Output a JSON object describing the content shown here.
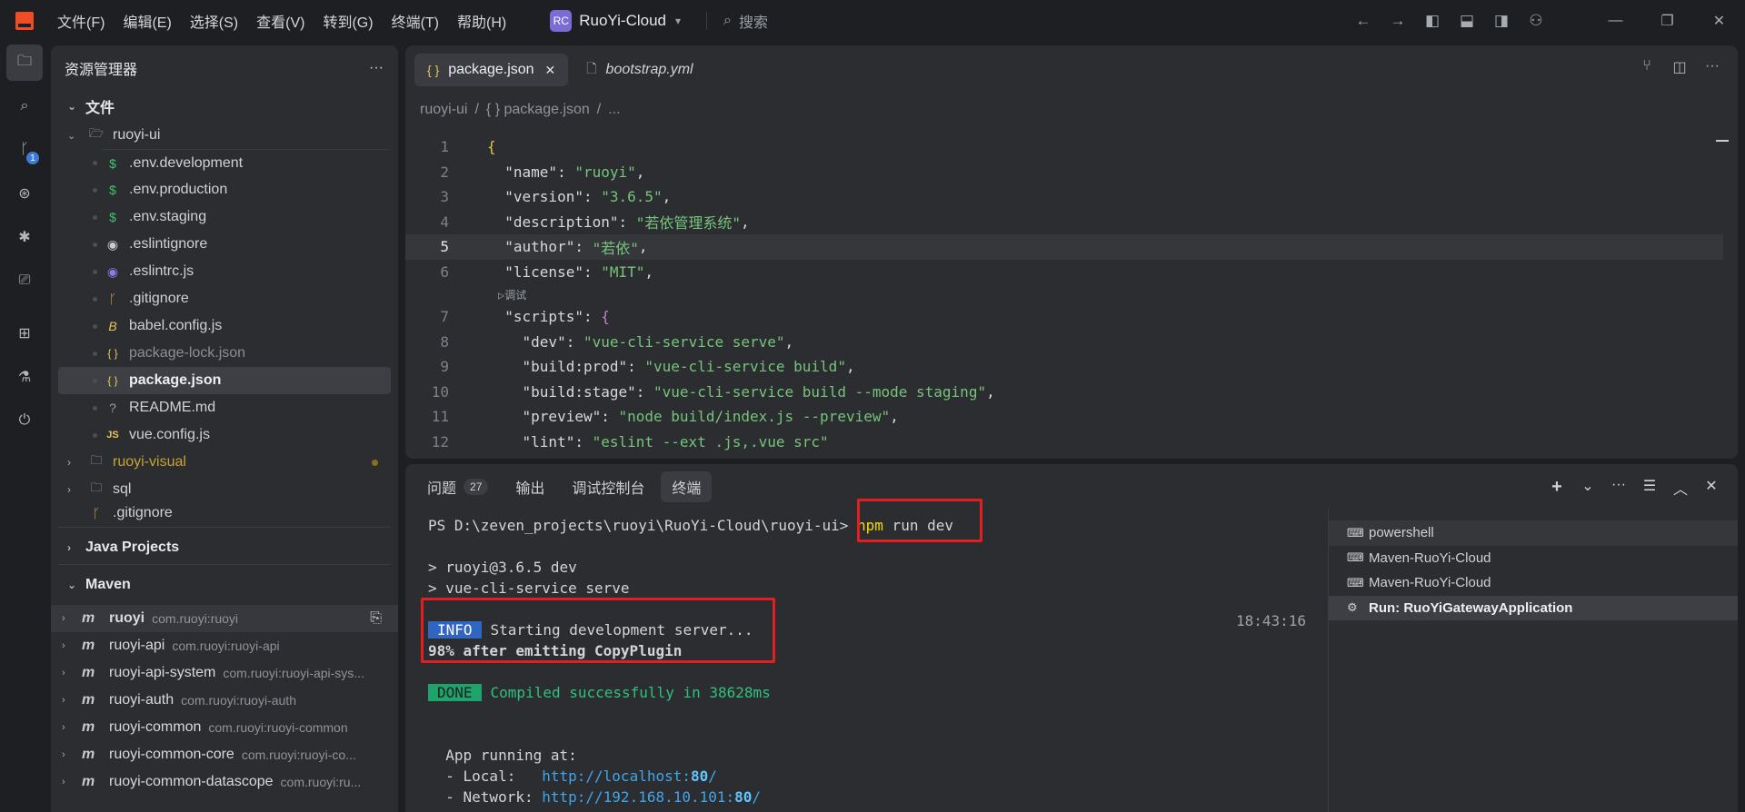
{
  "titlebar": {
    "menu": [
      "文件(F)",
      "编辑(E)",
      "选择(S)",
      "查看(V)",
      "转到(G)",
      "终端(T)",
      "帮助(H)"
    ],
    "project_badge": "RC",
    "project_name": "RuoYi-Cloud",
    "search_placeholder": "搜索",
    "colors": {
      "logo": "#f24c24",
      "project_badge": "#7b6bd6"
    }
  },
  "activitybar": {
    "items": [
      "explorer-icon",
      "search-icon",
      "source-control-icon",
      "remote-icon",
      "debug-icon",
      "remote-explorer-icon",
      "extensions-icon",
      "testing-icon",
      "power-icon"
    ],
    "source_control_badge": "1"
  },
  "sidebar": {
    "title": "资源管理器",
    "more": "···",
    "files_section": "文件",
    "root_folder": "ruoyi-ui",
    "files": [
      {
        "icon": "$",
        "name": ".env.development"
      },
      {
        "icon": "$",
        "name": ".env.production"
      },
      {
        "icon": "$",
        "name": ".env.staging"
      },
      {
        "icon": "◉",
        "name": ".eslintignore"
      },
      {
        "icon": "◉",
        "name": ".eslintrc.js"
      },
      {
        "icon": "ᚴ",
        "name": ".gitignore"
      },
      {
        "icon": "B",
        "name": "babel.config.js"
      },
      {
        "icon": "{ }",
        "name": "package-lock.json"
      },
      {
        "icon": "{ }",
        "name": "package.json"
      },
      {
        "icon": "?",
        "name": "README.md"
      },
      {
        "icon": "JS",
        "name": "vue.config.js"
      }
    ],
    "folders": [
      "ruoyi-visual",
      "sql"
    ],
    "root_gitignore": ".gitignore",
    "java_section": "Java Projects",
    "maven_section": "Maven",
    "maven": [
      {
        "name": "ruoyi",
        "gid": "com.ruoyi:ruoyi"
      },
      {
        "name": "ruoyi-api",
        "gid": "com.ruoyi:ruoyi-api"
      },
      {
        "name": "ruoyi-api-system",
        "gid": "com.ruoyi:ruoyi-api-sys..."
      },
      {
        "name": "ruoyi-auth",
        "gid": "com.ruoyi:ruoyi-auth"
      },
      {
        "name": "ruoyi-common",
        "gid": "com.ruoyi:ruoyi-common"
      },
      {
        "name": "ruoyi-common-core",
        "gid": "com.ruoyi:ruoyi-co..."
      },
      {
        "name": "ruoyi-common-datascope",
        "gid": "com.ruoyi:ru..."
      }
    ]
  },
  "editor": {
    "tabs": [
      {
        "icon": "{ }",
        "label": "package.json",
        "close": "✕"
      },
      {
        "icon": "🗋",
        "label": "bootstrap.yml"
      }
    ],
    "breadcrumb": [
      "ruoyi-ui",
      "{ } package.json",
      "..."
    ],
    "codelens": "▷调试",
    "lines": [
      {
        "n": "1",
        "parts": [
          [
            "brace-y",
            "{"
          ]
        ]
      },
      {
        "n": "2",
        "parts": [
          [
            "k",
            "  \"name\""
          ],
          [
            "p",
            ": "
          ],
          [
            "s",
            "\"ruoyi\""
          ],
          [
            "p",
            ","
          ]
        ]
      },
      {
        "n": "3",
        "parts": [
          [
            "k",
            "  \"version\""
          ],
          [
            "p",
            ": "
          ],
          [
            "s",
            "\"3.6.5\""
          ],
          [
            "p",
            ","
          ]
        ]
      },
      {
        "n": "4",
        "parts": [
          [
            "k",
            "  \"description\""
          ],
          [
            "p",
            ": "
          ],
          [
            "s",
            "\"若依管理系统\""
          ],
          [
            "p",
            ","
          ]
        ]
      },
      {
        "n": "5",
        "parts": [
          [
            "k",
            "  \"author\""
          ],
          [
            "p",
            ": "
          ],
          [
            "s",
            "\"若依\""
          ],
          [
            "p",
            ","
          ]
        ]
      },
      {
        "n": "6",
        "parts": [
          [
            "k",
            "  \"license\""
          ],
          [
            "p",
            ": "
          ],
          [
            "s",
            "\"MIT\""
          ],
          [
            "p",
            ","
          ]
        ]
      },
      {
        "n": "7",
        "parts": [
          [
            "k",
            "  \"scripts\""
          ],
          [
            "p",
            ": "
          ],
          [
            "brace-p",
            "{"
          ]
        ]
      },
      {
        "n": "8",
        "parts": [
          [
            "k",
            "    \"dev\""
          ],
          [
            "p",
            ": "
          ],
          [
            "s",
            "\"vue-cli-service serve\""
          ],
          [
            "p",
            ","
          ]
        ]
      },
      {
        "n": "9",
        "parts": [
          [
            "k",
            "    \"build:prod\""
          ],
          [
            "p",
            ": "
          ],
          [
            "s",
            "\"vue-cli-service build\""
          ],
          [
            "p",
            ","
          ]
        ]
      },
      {
        "n": "10",
        "parts": [
          [
            "k",
            "    \"build:stage\""
          ],
          [
            "p",
            ": "
          ],
          [
            "s",
            "\"vue-cli-service build --mode staging\""
          ],
          [
            "p",
            ","
          ]
        ]
      },
      {
        "n": "11",
        "parts": [
          [
            "k",
            "    \"preview\""
          ],
          [
            "p",
            ": "
          ],
          [
            "s",
            "\"node build/index.js --preview\""
          ],
          [
            "p",
            ","
          ]
        ]
      },
      {
        "n": "12",
        "parts": [
          [
            "k",
            "    \"lint\""
          ],
          [
            "p",
            ": "
          ],
          [
            "s",
            "\"eslint --ext .js,.vue src\""
          ]
        ]
      }
    ]
  },
  "panel": {
    "tabs": [
      {
        "label": "问题",
        "count": "27"
      },
      {
        "label": "输出"
      },
      {
        "label": "调试控制台"
      },
      {
        "label": "终端"
      }
    ],
    "prompt": "PS D:\\zeven_projects\\ruoyi\\RuoYi-Cloud\\ruoyi-ui> ",
    "cmd_npm": "npm",
    "cmd_rest": " run dev",
    "out1": "> ruoyi@3.6.5 dev",
    "out2": "> vue-cli-service serve",
    "info_badge": "INFO",
    "info_text": "Starting development server...",
    "progress": "98% after emitting CopyPlugin",
    "done_badge": "DONE",
    "done_text": "Compiled successfully in 38628ms",
    "timestamp": "18:43:16",
    "app_running": "  App running at:",
    "local_label": "  - Local:   ",
    "local_url": "http://localhost:",
    "local_port": "80",
    "local_tail": "/",
    "network_label": "  - Network: ",
    "network_url": "http://192.168.10.101:",
    "network_port": "80",
    "network_tail": "/",
    "terminals": [
      {
        "icon": "⌨",
        "label": "powershell"
      },
      {
        "icon": "⌨",
        "label": "Maven-RuoYi-Cloud"
      },
      {
        "icon": "⌨",
        "label": "Maven-RuoYi-Cloud"
      },
      {
        "icon": "⚙",
        "label": "Run: RuoYiGatewayApplication"
      }
    ]
  }
}
